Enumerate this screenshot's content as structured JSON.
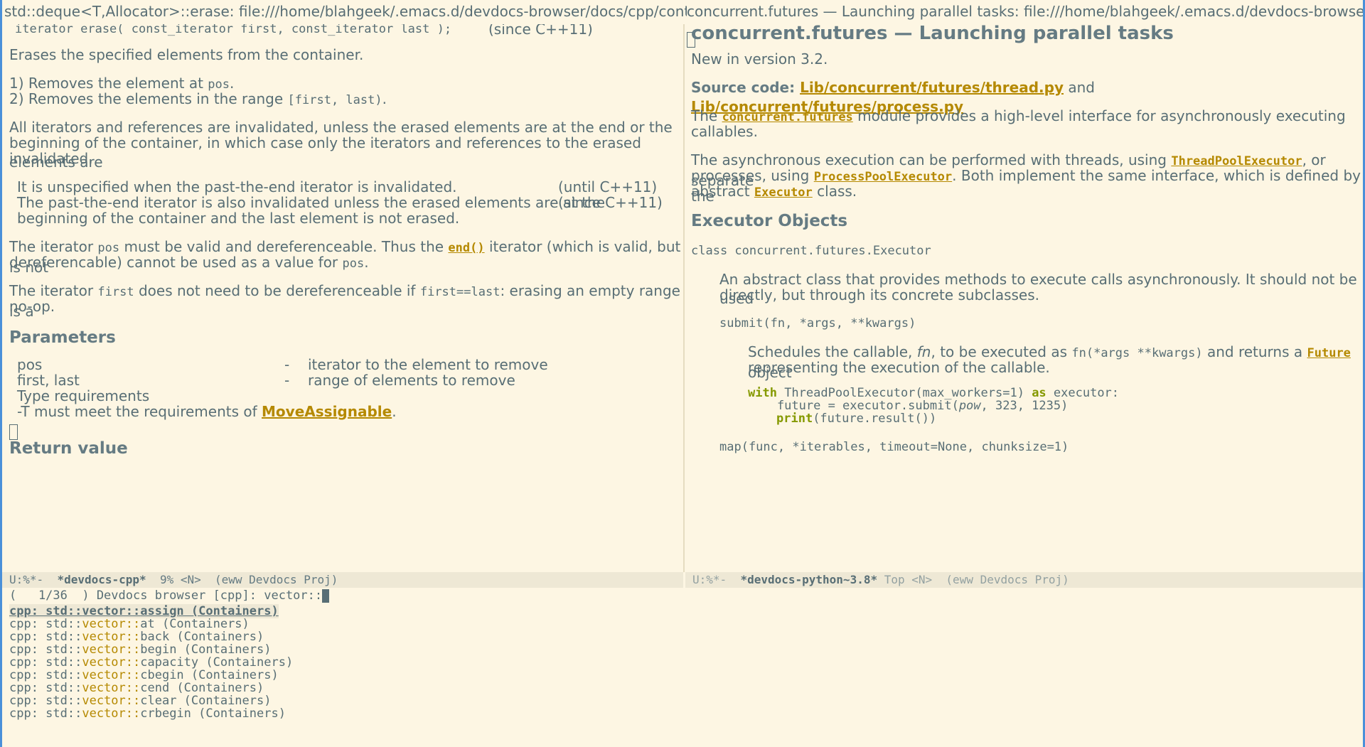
{
  "window": {
    "title_left": "std::deque<T,Allocator>::erase:  file:///home/blahgeek/.emacs.d/devdocs-browser/docs/cpp/content/cont",
    "title_right": "concurrent.futures — Launching parallel tasks:  file:///home/blahgeek/.emacs.d/devdocs-browser/docs/p"
  },
  "left": {
    "signature": "iterator erase( const_iterator first, const_iterator last );",
    "signature_note": "(since C++11)",
    "intro": "Erases the specified elements from the container.",
    "item1_a": "1) Removes the element at ",
    "item1_code": "pos",
    "item1_b": ".",
    "item2_a": "2) Removes the elements in the range ",
    "item2_code": "[first, last)",
    "item2_b": ".",
    "invalidate_1": "All iterators and references are invalidated, unless the erased elements are at the end or the",
    "invalidate_2": "beginning of the container, in which case only the iterators and references to the erased elements are",
    "invalidate_3": "invalidated.",
    "table_row1": "It is unspecified when the past-the-end iterator is invalidated.",
    "table_row1_note": "(until C++11)",
    "table_row2a": "The past-the-end iterator is also invalidated unless the erased elements are at the",
    "table_row2b": "beginning of the container and the last element is not erased.",
    "table_row2_note": "(since C++11)",
    "pos_para_1a": "The iterator ",
    "pos_para_1code": "pos",
    "pos_para_1b": " must be valid and dereferenceable. Thus the ",
    "pos_para_link": "end()",
    "pos_para_1c": " iterator (which is valid, but is not",
    "pos_para_2a": "dereferencable) cannot be used as a value for ",
    "pos_para_2code": "pos",
    "pos_para_2b": ".",
    "first_para_1a": "The iterator ",
    "first_para_1code": "first",
    "first_para_1b": " does not need to be dereferenceable if ",
    "first_para_1code2": "first==last",
    "first_para_1c": ": erasing an empty range is a",
    "first_para_2": "no-op.",
    "params_heading": "Parameters",
    "params": [
      {
        "name": "pos",
        "dash": "-",
        "desc": "iterator to the element to remove"
      },
      {
        "name": "first, last",
        "dash": "-",
        "desc": "range of elements to remove"
      }
    ],
    "type_req": "Type requirements",
    "type_req_line_a": "-T must meet the requirements of ",
    "type_req_link": "MoveAssignable",
    "type_req_line_b": ".",
    "return_heading": "Return value"
  },
  "right": {
    "heading": "concurrent.futures — Launching parallel tasks",
    "new_in": "New in version 3.2.",
    "source_label": "Source code: ",
    "source_link1": "Lib/concurrent/futures/thread.py",
    "source_and": " and ",
    "source_link2": "Lib/concurrent/futures/process.py",
    "mod_a": "The ",
    "mod_link": "concurrent.futures",
    "mod_b": " module provides a high-level interface for asynchronously executing",
    "mod_c": "callables.",
    "async_a": "The asynchronous execution can be performed with threads, using ",
    "async_link1": "ThreadPoolExecutor",
    "async_b": ", or separate",
    "async_c": "processes, using ",
    "async_link2": "ProcessPoolExecutor",
    "async_d": ". Both implement the same interface, which is defined by the",
    "async_e": "abstract ",
    "async_link3": "Executor",
    "async_f": " class.",
    "exec_heading": "Executor Objects",
    "class_sig": "class concurrent.futures.Executor",
    "class_desc_1": "An abstract class that provides methods to execute calls asynchronously. It should not be used",
    "class_desc_2": "directly, but through its concrete subclasses.",
    "submit_sig": "submit(fn, *args, **kwargs)",
    "submit_a": "Schedules the callable, ",
    "submit_fn": "fn",
    "submit_b": ", to be executed as ",
    "submit_code": "fn(*args **kwargs)",
    "submit_c": " and returns a ",
    "submit_link": "Future",
    "submit_d": " object",
    "submit_e": "representing the execution of the callable.",
    "code_1_kw": "with",
    "code_1_a": " ThreadPoolExecutor(max_workers=1) ",
    "code_1_kw2": "as",
    "code_1_b": " executor:",
    "code_2_a": "    future = executor.submit(",
    "code_2_it": "pow",
    "code_2_b": ", 323, 1235)",
    "code_3_kw": "print",
    "code_3_b": "(future.result())",
    "map_sig": "map(func, *iterables, timeout=None, chunksize=1)"
  },
  "modeline_left": {
    "state": "U:%*-  ",
    "buffer": "*devdocs-cpp*",
    "rest": "  9% <N>  (eww Devdocs Proj)"
  },
  "modeline_right": {
    "state": "U:%*-  ",
    "buffer": "*devdocs-python~3.8*",
    "rest": " Top <N>  (eww Devdocs Proj)"
  },
  "minibuffer": {
    "prompt": "(   1/36  ) Devdocs browser [cpp]: ",
    "input": "vector::",
    "candidates": [
      {
        "prefix": "cpp: std::",
        "match": "vector::",
        "rest": "assign (Containers)"
      },
      {
        "prefix": "cpp: std::",
        "match": "vector::",
        "rest": "at (Containers)"
      },
      {
        "prefix": "cpp: std::",
        "match": "vector::",
        "rest": "back (Containers)"
      },
      {
        "prefix": "cpp: std::",
        "match": "vector::",
        "rest": "begin (Containers)"
      },
      {
        "prefix": "cpp: std::",
        "match": "vector::",
        "rest": "capacity (Containers)"
      },
      {
        "prefix": "cpp: std::",
        "match": "vector::",
        "rest": "cbegin (Containers)"
      },
      {
        "prefix": "cpp: std::",
        "match": "vector::",
        "rest": "cend (Containers)"
      },
      {
        "prefix": "cpp: std::",
        "match": "vector::",
        "rest": "clear (Containers)"
      },
      {
        "prefix": "cpp: std::",
        "match": "vector::",
        "rest": "crbegin (Containers)"
      }
    ]
  }
}
